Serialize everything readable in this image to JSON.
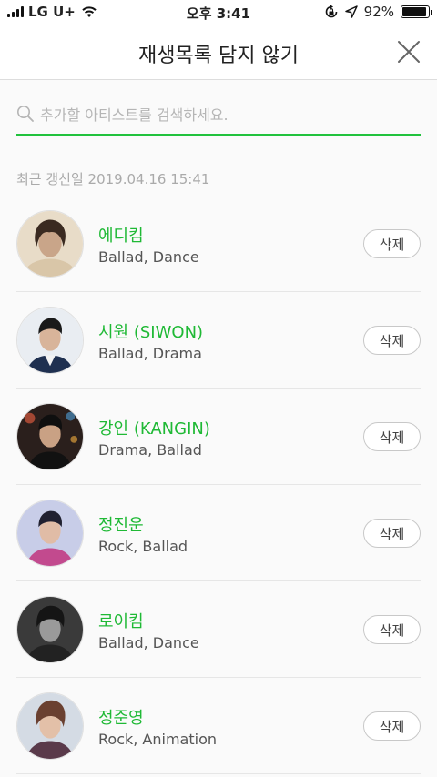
{
  "status_bar": {
    "carrier": "LG U+",
    "time": "오후 3:41",
    "battery_percent": "92%",
    "battery_level": 0.92
  },
  "header": {
    "title": "재생목록 담지 않기"
  },
  "search": {
    "placeholder": "추가할 아티스트를 검색하세요.",
    "value": ""
  },
  "updated_text": "최근 갱신일 2019.04.16 15:41",
  "colors": {
    "accent": "#21c23d",
    "artist_name": "#1fb935"
  },
  "artists": [
    {
      "name": "에디킴",
      "genre": "Ballad, Dance",
      "delete_label": "삭제"
    },
    {
      "name": "시원 (SIWON)",
      "genre": "Ballad, Drama",
      "delete_label": "삭제"
    },
    {
      "name": "강인 (KANGIN)",
      "genre": "Drama, Ballad",
      "delete_label": "삭제"
    },
    {
      "name": "정진운",
      "genre": "Rock, Ballad",
      "delete_label": "삭제"
    },
    {
      "name": "로이킴",
      "genre": "Ballad, Dance",
      "delete_label": "삭제"
    },
    {
      "name": "정준영",
      "genre": "Rock, Animation",
      "delete_label": "삭제"
    }
  ]
}
